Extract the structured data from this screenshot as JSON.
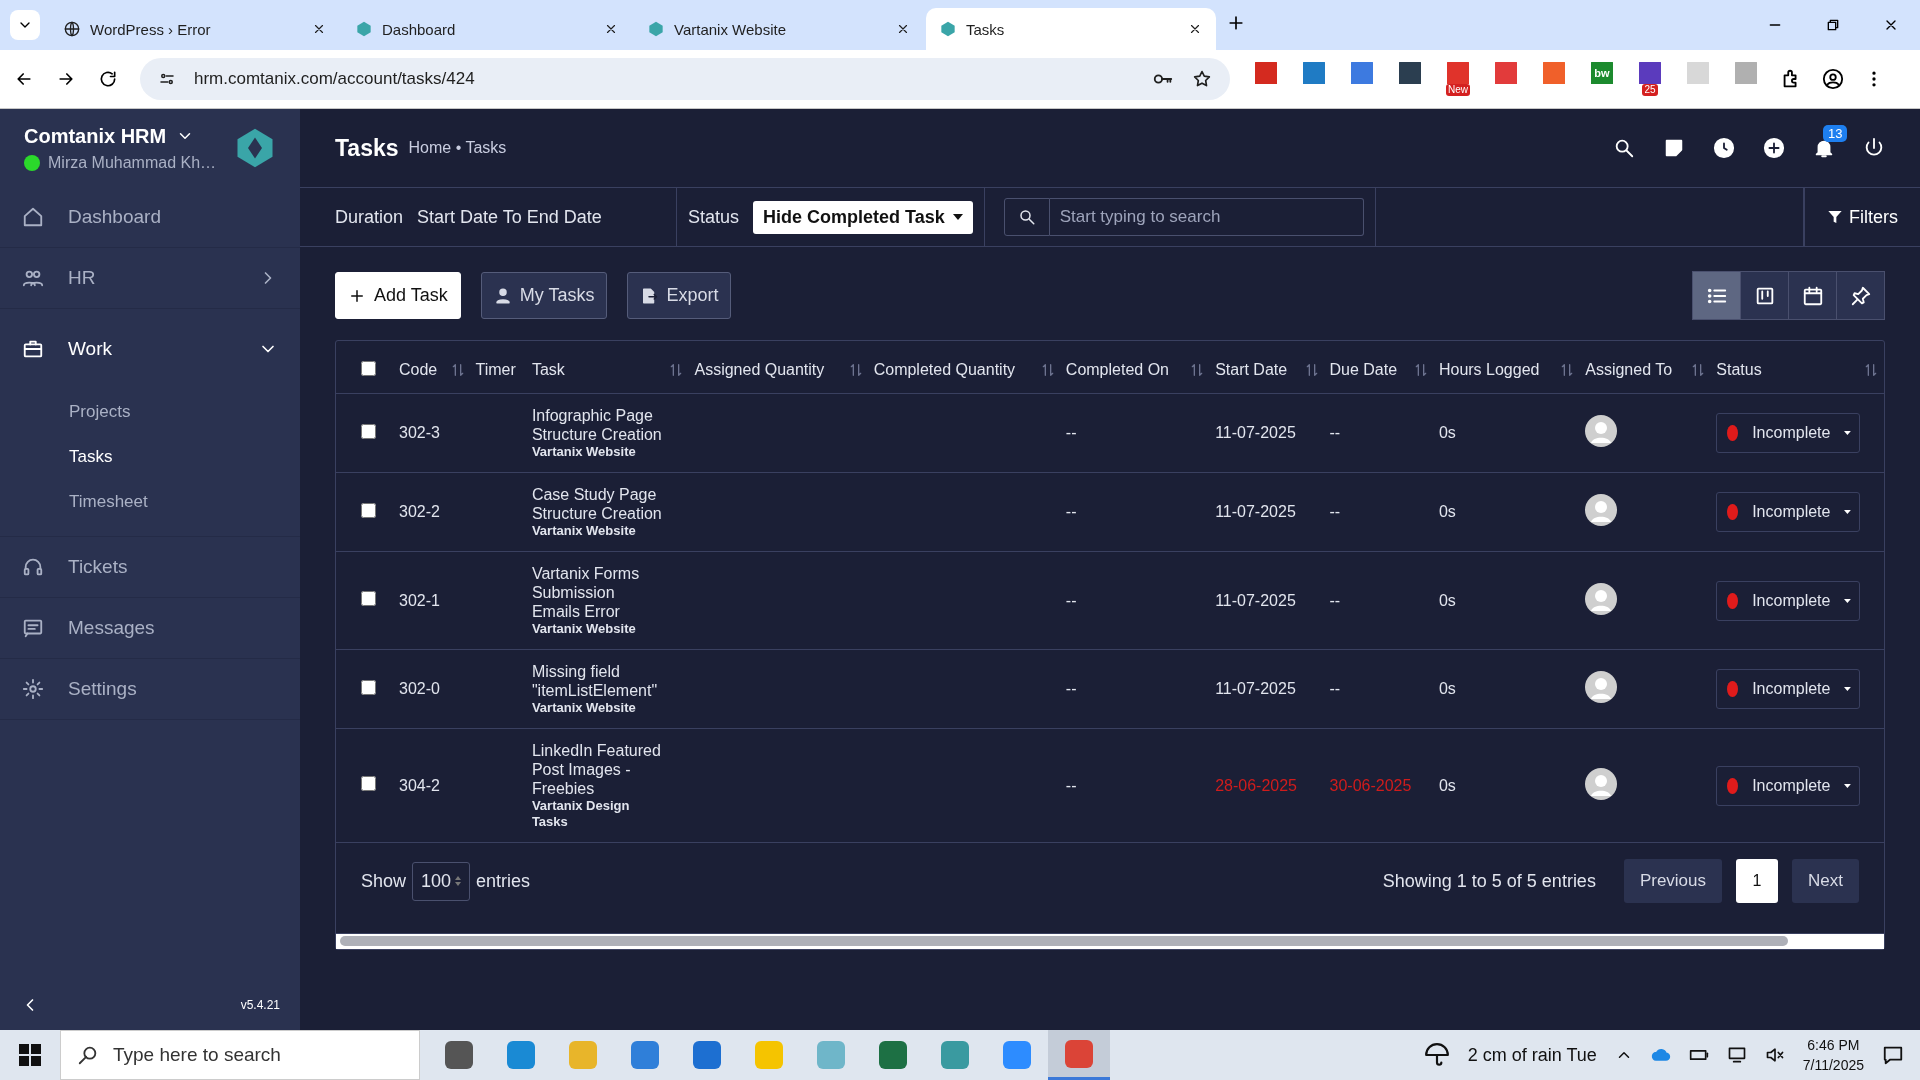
{
  "browser": {
    "tabs": [
      {
        "title": "WordPress › Error",
        "selected": false
      },
      {
        "title": "Dashboard",
        "selected": false
      },
      {
        "title": "Vartanix Website",
        "selected": false
      },
      {
        "title": "Tasks",
        "selected": true
      }
    ],
    "url": "hrm.comtanix.com/account/tasks/424",
    "extensions": [
      {
        "color": "#d42a1f"
      },
      {
        "color": "#1f7bc4"
      },
      {
        "color": "#3d7ae0"
      },
      {
        "color": "#2b3e50"
      },
      {
        "color": "#e0332b",
        "badge": "New"
      },
      {
        "color": "#e23b3b"
      },
      {
        "color": "#f0602a"
      },
      {
        "color": "#1c8a2e",
        "badge_text": "bw"
      },
      {
        "color": "#5b3bbd",
        "badge": "25"
      },
      {
        "color": "#d8d8d8"
      },
      {
        "color": "#b0b0b0"
      }
    ]
  },
  "sidebar": {
    "company": "Comtanix HRM",
    "user": "Mirza Muhammad Kh…",
    "online": true,
    "items": [
      {
        "label": "Dashboard",
        "selected": false
      },
      {
        "label": "HR",
        "selected": false,
        "expanded": false
      },
      {
        "label": "Work",
        "selected": false,
        "expanded": true,
        "children": [
          {
            "label": "Projects",
            "selected": false
          },
          {
            "label": "Tasks",
            "selected": true
          },
          {
            "label": "Timesheet",
            "selected": false
          }
        ]
      },
      {
        "label": "Tickets",
        "selected": false
      },
      {
        "label": "Messages",
        "selected": false
      },
      {
        "label": "Settings",
        "selected": false
      }
    ],
    "version": "v5.4.21"
  },
  "header": {
    "title": "Tasks",
    "breadcrumb": "Home • Tasks",
    "notification_count": "13"
  },
  "filters": {
    "duration_label": "Duration",
    "duration_value": "Start Date To End Date",
    "status_label": "Status",
    "status_value": "Hide Completed Task",
    "search_placeholder": "Start typing to search",
    "filters_button": "Filters"
  },
  "actions": {
    "buttons": [
      {
        "label": "Add Task",
        "kind": "primary"
      },
      {
        "label": "My Tasks",
        "kind": "user"
      },
      {
        "label": "Export",
        "kind": "export"
      }
    ],
    "views": [
      {
        "selected": true
      },
      {
        "selected": false
      },
      {
        "selected": false
      },
      {
        "selected": false
      }
    ]
  },
  "table": {
    "all_checked": false,
    "columns": [
      {
        "label": "Code",
        "sortable": true
      },
      {
        "label": "Timer",
        "sortable": false
      },
      {
        "label": "Task",
        "sortable": true
      },
      {
        "label": "Assigned Quantity",
        "sortable": true
      },
      {
        "label": "Completed Quantity",
        "sortable": true
      },
      {
        "label": "Completed On",
        "sortable": true
      },
      {
        "label": "Start Date",
        "sortable": true
      },
      {
        "label": "Due Date",
        "sortable": true
      },
      {
        "label": "Hours Logged",
        "sortable": true
      },
      {
        "label": "Assigned To",
        "sortable": true
      },
      {
        "label": "Status",
        "sortable": true
      }
    ],
    "rows": [
      {
        "checked": false,
        "code": "302-3",
        "task": "Infographic Page Structure Creation",
        "project": "Vartanix Website",
        "completed_on": "--",
        "start_date": "11-07-2025",
        "due_date": "--",
        "hours": "0s",
        "status": "Incomplete",
        "color": "#e01b1b",
        "overdue": false
      },
      {
        "checked": false,
        "code": "302-2",
        "task": "Case Study Page Structure Creation",
        "project": "Vartanix Website",
        "completed_on": "--",
        "start_date": "11-07-2025",
        "due_date": "--",
        "hours": "0s",
        "status": "Incomplete",
        "color": "#e01b1b",
        "overdue": false
      },
      {
        "checked": false,
        "code": "302-1",
        "task": "Vartanix Forms Submission Emails Error",
        "project": "Vartanix Website",
        "completed_on": "--",
        "start_date": "11-07-2025",
        "due_date": "--",
        "hours": "0s",
        "status": "Incomplete",
        "color": "#e01b1b",
        "overdue": false
      },
      {
        "checked": false,
        "code": "302-0",
        "task": "Missing field \"itemListElement\"",
        "project": "Vartanix Website",
        "completed_on": "--",
        "start_date": "11-07-2025",
        "due_date": "--",
        "hours": "0s",
        "status": "Incomplete",
        "color": "#e01b1b",
        "overdue": false
      },
      {
        "checked": false,
        "code": "304-2",
        "task": "LinkedIn Featured Post Images - Freebies",
        "project": "Vartanix Design Tasks",
        "completed_on": "--",
        "start_date": "28-06-2025",
        "due_date": "30-06-2025",
        "hours": "0s",
        "status": "Incomplete",
        "color": "#e01b1b",
        "overdue": true
      }
    ],
    "show_label": "Show",
    "page_size": "100",
    "entries_label": "entries",
    "info": "Showing 1 to 5 of 5 entries",
    "previous": "Previous",
    "pages": [
      {
        "label": "1",
        "selected": true
      }
    ],
    "next": "Next"
  },
  "taskbar": {
    "search_placeholder": "Type here to search",
    "apps": [
      {
        "color": "#555555",
        "active": false
      },
      {
        "color": "#1a8ad4",
        "active": false
      },
      {
        "color": "#e8b52a",
        "active": false
      },
      {
        "color": "#2f7fd9",
        "active": false
      },
      {
        "color": "#1d6fd1",
        "active": false
      },
      {
        "color": "#f5c400",
        "active": false
      },
      {
        "color": "#6fb6c9",
        "active": false
      },
      {
        "color": "#1d7044",
        "active": false
      },
      {
        "color": "#3a9aa0",
        "active": false
      },
      {
        "color": "#2d8cff",
        "active": false
      },
      {
        "color": "#db4437",
        "active": true
      }
    ],
    "weather": "2 cm of rain Tue",
    "time": "6:46 PM",
    "date": "7/11/2025"
  }
}
